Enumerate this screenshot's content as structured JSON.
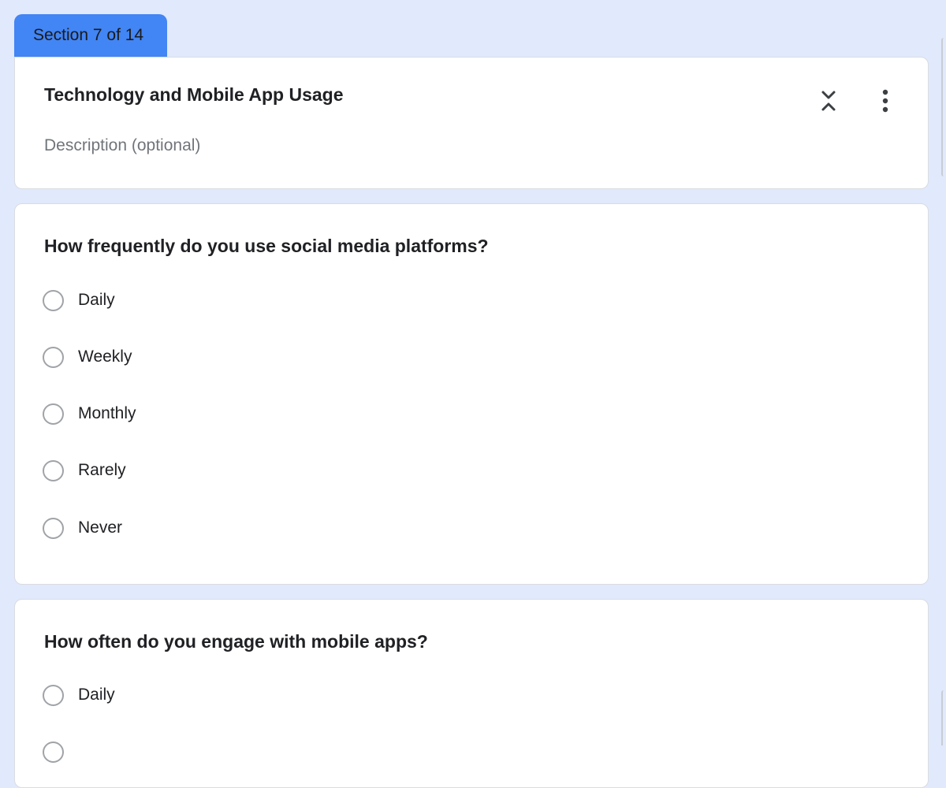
{
  "section_tab": {
    "label": "Section 7 of 14"
  },
  "section": {
    "title": "Technology and Mobile App Usage",
    "description_placeholder": "Description (optional)",
    "icons": [
      "collapse-icon",
      "more-vertical-icon"
    ]
  },
  "questions": [
    {
      "title": "How frequently do you use social media platforms?",
      "options": [
        "Daily",
        "Weekly",
        "Monthly",
        "Rarely",
        "Never"
      ]
    },
    {
      "title": "How often do you engage with mobile apps?",
      "options": [
        "Daily"
      ]
    }
  ],
  "colors": {
    "background": "#e1e9fc",
    "accent": "#4285f4",
    "card": "#ffffff"
  }
}
